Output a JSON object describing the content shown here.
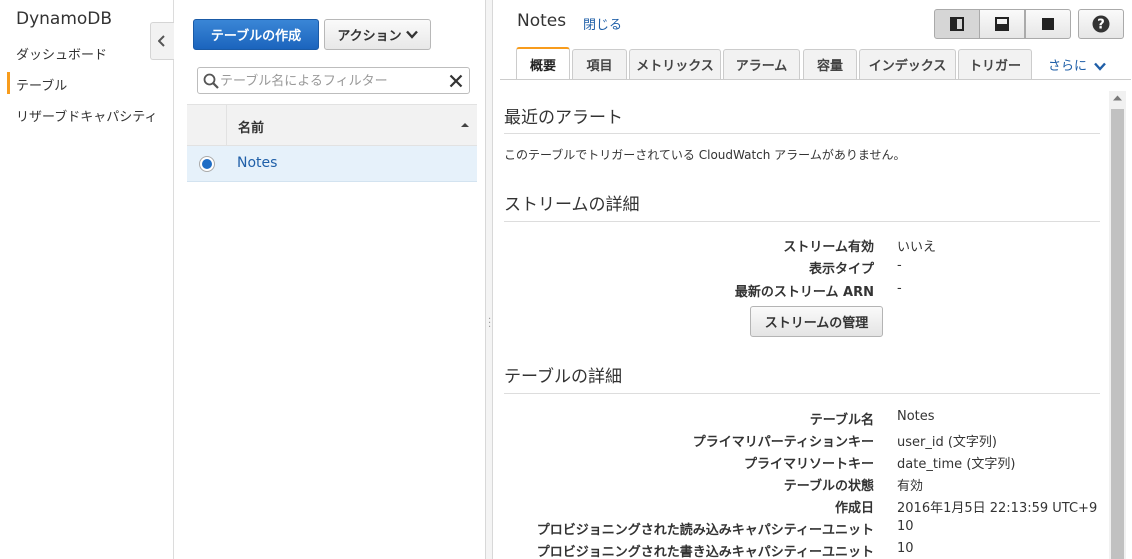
{
  "nav": {
    "title": "DynamoDB",
    "items": [
      {
        "label": "ダッシュボード"
      },
      {
        "label": "テーブル",
        "active": true
      },
      {
        "label": "リザーブドキャパシティ"
      }
    ]
  },
  "list": {
    "create_button": "テーブルの作成",
    "actions_button": "アクション",
    "search_placeholder": "テーブル名によるフィルター",
    "column_header": "名前",
    "rows": [
      {
        "name": "Notes",
        "selected": true
      }
    ]
  },
  "detail": {
    "title": "Notes",
    "close_link": "閉じる",
    "tabs": [
      "概要",
      "項目",
      "メトリックス",
      "アラーム",
      "容量",
      "インデックス",
      "トリガー"
    ],
    "active_tab": "概要",
    "more_tab": "さらに",
    "alarms": {
      "heading": "最近のアラート",
      "message": "このテーブルでトリガーされている CloudWatch アラームがありません。"
    },
    "stream": {
      "heading": "ストリームの詳細",
      "fields": [
        {
          "label": "ストリーム有効",
          "value": "いいえ"
        },
        {
          "label": "表示タイプ",
          "value": "-"
        },
        {
          "label": "最新のストリーム ARN",
          "value": "-"
        }
      ],
      "manage_button": "ストリームの管理"
    },
    "table": {
      "heading": "テーブルの詳細",
      "fields": [
        {
          "label": "テーブル名",
          "value": "Notes"
        },
        {
          "label": "プライマリパーティションキー",
          "value": "user_id (文字列)"
        },
        {
          "label": "プライマリソートキー",
          "value": "date_time (文字列)"
        },
        {
          "label": "テーブルの状態",
          "value": "有効"
        },
        {
          "label": "作成日",
          "value": "2016年1月5日 22:13:59 UTC+9"
        },
        {
          "label": "プロビジョニングされた読み込みキャパシティーユニット",
          "value": "10"
        },
        {
          "label": "プロビジョニングされた書き込みキャパシティーユニット",
          "value": "10"
        }
      ]
    }
  },
  "colors": {
    "primary_button": "#1b64bd",
    "active_tab_accent": "#f89c1c",
    "link": "#1f5fa8",
    "selected_row": "#e6f1fa"
  },
  "icons": [
    "collapse-left-icon",
    "chevron-down-icon",
    "search-icon",
    "clear-icon",
    "sort-up-icon",
    "layout-split-icon",
    "layout-bottom-icon",
    "layout-full-icon",
    "help-icon"
  ]
}
